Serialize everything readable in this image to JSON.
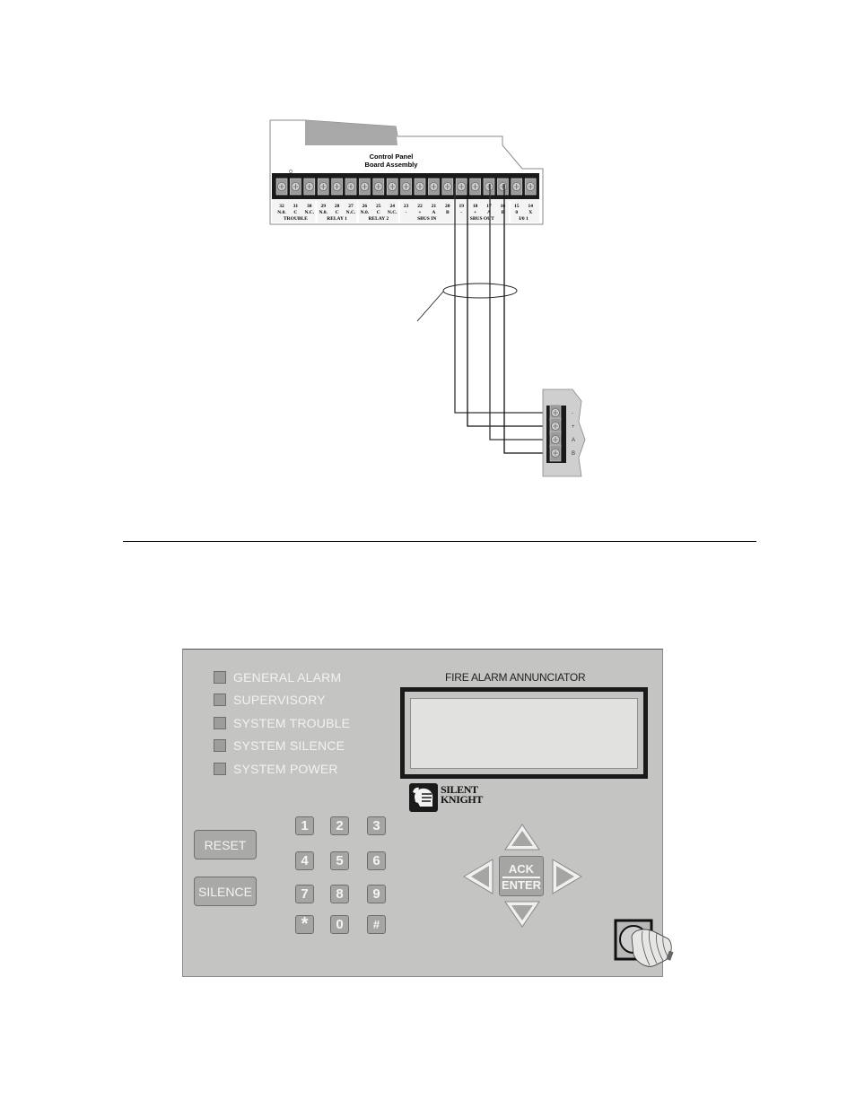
{
  "wiring_diagram": {
    "board": {
      "title_line1": "Control Panel",
      "title_line2": "Board Assembly",
      "terminals": [
        {
          "num": "32",
          "label": "N.0."
        },
        {
          "num": "31",
          "label": "C"
        },
        {
          "num": "30",
          "label": "N.C."
        },
        {
          "num": "29",
          "label": "N.0."
        },
        {
          "num": "28",
          "label": "C"
        },
        {
          "num": "27",
          "label": "N.C."
        },
        {
          "num": "26",
          "label": "N.0."
        },
        {
          "num": "25",
          "label": "C"
        },
        {
          "num": "24",
          "label": "N.C."
        },
        {
          "num": "23",
          "label": "-"
        },
        {
          "num": "22",
          "label": "+"
        },
        {
          "num": "21",
          "label": "A"
        },
        {
          "num": "20",
          "label": "B"
        },
        {
          "num": "19",
          "label": "-"
        },
        {
          "num": "18",
          "label": "+"
        },
        {
          "num": "17",
          "label": "A"
        },
        {
          "num": "16",
          "label": "B"
        },
        {
          "num": "15",
          "label": "0"
        },
        {
          "num": "14",
          "label": "X"
        }
      ],
      "groups": [
        "TROUBLE",
        "RELAY 1",
        "RELAY 2",
        "SBUS IN",
        "SBUS OUT",
        "I/0 1"
      ]
    },
    "remote_terminals": [
      "-",
      "+",
      "A",
      "B"
    ],
    "connections": [
      {
        "from": "19 -",
        "to": "-"
      },
      {
        "from": "18 +",
        "to": "+"
      },
      {
        "from": "17 A",
        "to": "A"
      },
      {
        "from": "16 B",
        "to": "B"
      }
    ]
  },
  "annunciator": {
    "leds": [
      {
        "label": "GENERAL ALARM"
      },
      {
        "label": "SUPERVISORY"
      },
      {
        "label": "SYSTEM TROUBLE"
      },
      {
        "label": "SYSTEM SILENCE"
      },
      {
        "label": "SYSTEM POWER"
      }
    ],
    "lcd_title": "FIRE ALARM ANNUNCIATOR",
    "lcd_text": "",
    "logo_line1": "SILENT",
    "logo_line2": "KNIGHT",
    "reset_label": "RESET",
    "silence_label": "SILENCE",
    "keypad": [
      "1",
      "2",
      "3",
      "4",
      "5",
      "6",
      "7",
      "8",
      "9",
      "*",
      "0",
      "#"
    ],
    "ack_top": "ACK",
    "ack_bottom": "ENTER",
    "arrows": [
      "up-arrow",
      "down-arrow",
      "left-arrow",
      "right-arrow"
    ]
  }
}
